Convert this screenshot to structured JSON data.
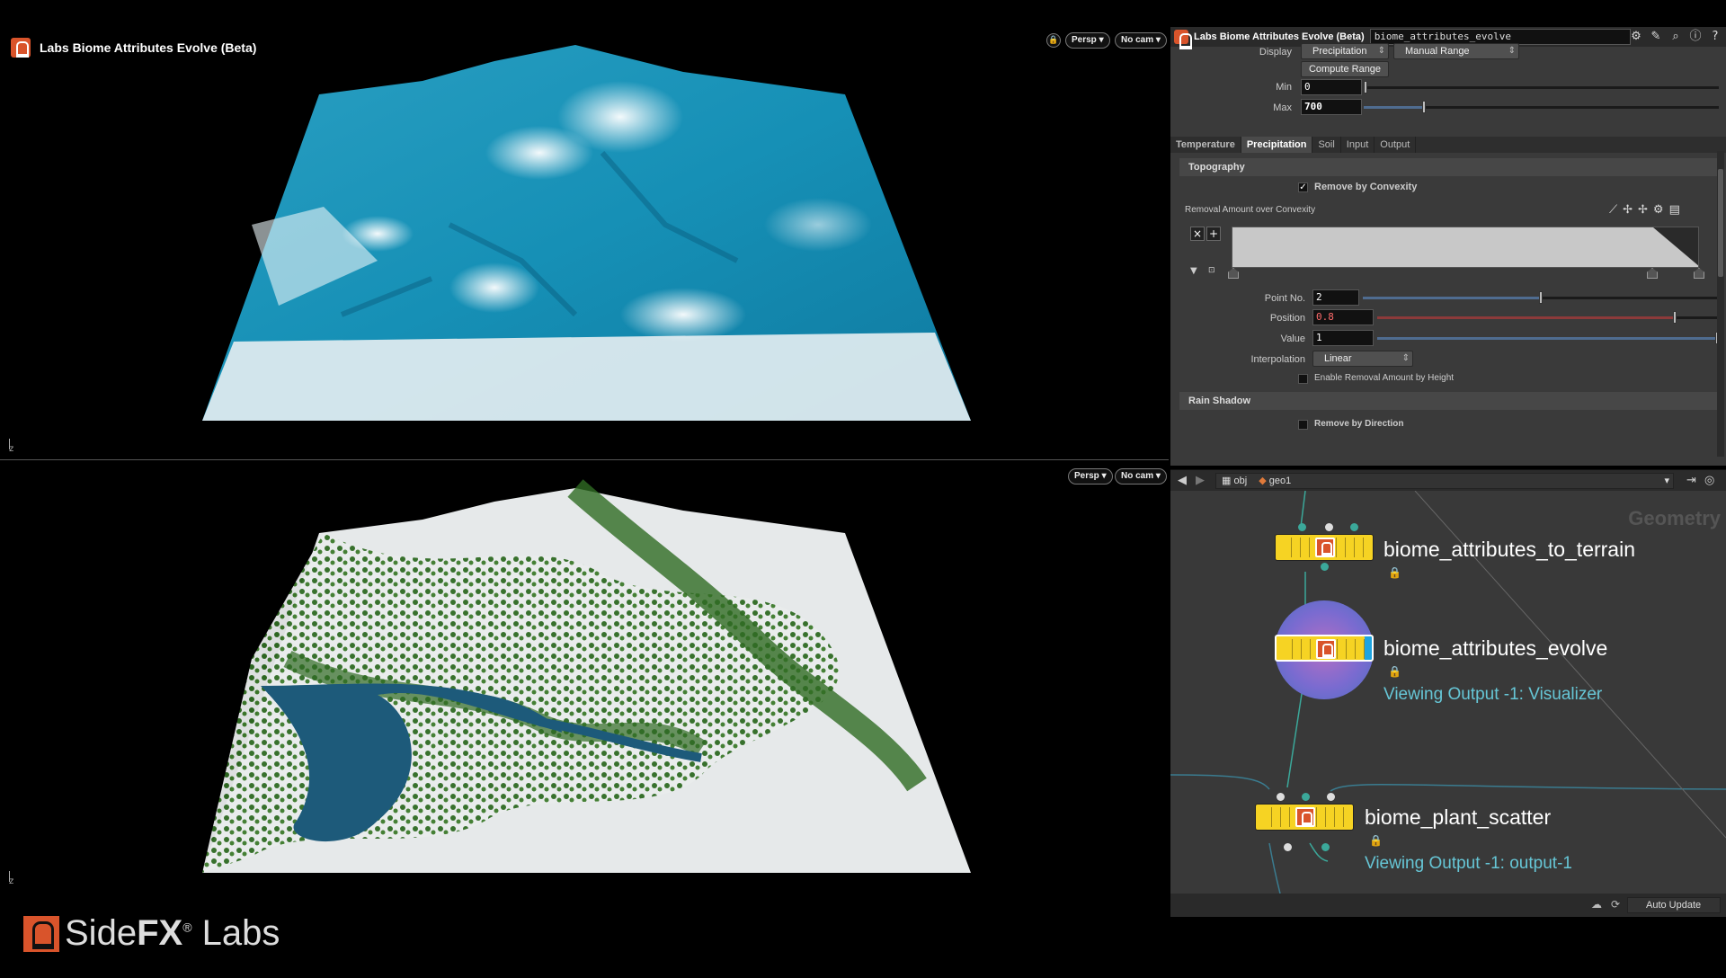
{
  "viewport_top": {
    "title": "Labs Biome Attributes Evolve (Beta)",
    "lock_icon": "lock-icon",
    "persp_label": "Persp",
    "cam_label": "No cam",
    "axes_label": "z"
  },
  "viewport_bottom": {
    "persp_label": "Persp",
    "cam_label": "No cam",
    "axes_label": "z"
  },
  "params": {
    "header_title": "Labs Biome Attributes Evolve (Beta)",
    "node_name": "biome_attributes_evolve",
    "display_label": "Display",
    "display_value": "Precipitation",
    "range_value": "Manual Range",
    "compute_range": "Compute Range",
    "min_label": "Min",
    "min_value": "0",
    "max_label": "Max",
    "max_value": "700",
    "max_fraction": 0.17,
    "tabs": [
      "Temperature",
      "Precipitation",
      "Soil",
      "Input",
      "Output"
    ],
    "active_tab": "Precipitation",
    "section_topography": "Topography",
    "remove_by_convexity": "Remove by Convexity",
    "removal_amount_label": "Removal Amount over Convexity",
    "point_no_label": "Point No.",
    "point_no_value": "2",
    "point_no_fraction": 0.5,
    "position_label": "Position",
    "position_value": "0.8",
    "position_fraction": 0.87,
    "value_label": "Value",
    "value_value": "1",
    "value_fraction": 1.0,
    "interpolation_label": "Interpolation",
    "interpolation_value": "Linear",
    "enable_removal_height": "Enable Removal Amount by Height",
    "section_rain_shadow": "Rain Shadow",
    "remove_by_direction": "Remove by Direction"
  },
  "network": {
    "path_obj": "obj",
    "path_geo": "geo1",
    "watermark": "Geometry",
    "nodes": [
      {
        "name": "biome_attributes_to_terrain",
        "sub": ""
      },
      {
        "name": "biome_attributes_evolve",
        "sub": "Viewing Output -1: Visualizer"
      },
      {
        "name": "biome_plant_scatter",
        "sub": "Viewing Output -1: output-1"
      }
    ],
    "auto_update": "Auto Update"
  },
  "brand": {
    "side": "Side",
    "fx": "FX",
    "labs": "Labs",
    "registered": "®"
  },
  "colors": {
    "node_yellow": "#f6d323",
    "accent_orange": "#d9542b",
    "wire_teal": "#3ba89a",
    "sub_text": "#66c6d6"
  }
}
